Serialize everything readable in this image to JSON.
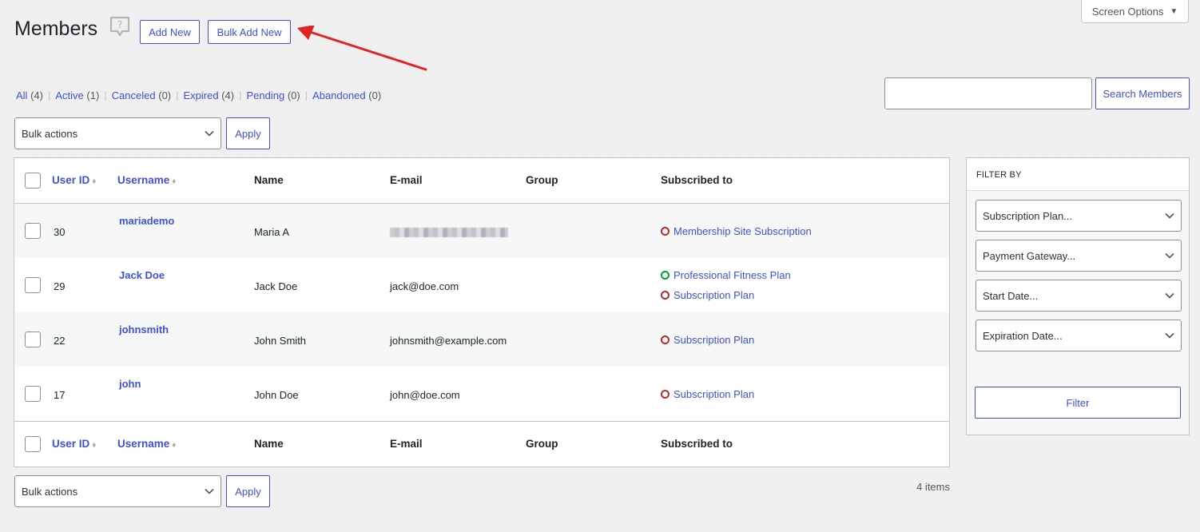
{
  "header": {
    "title": "Members",
    "add_new": "Add New",
    "bulk_add_new": "Bulk Add New",
    "screen_options": "Screen Options",
    "annotation_color": "#e02424"
  },
  "views": [
    {
      "label": "All",
      "count": "(4)",
      "current": true
    },
    {
      "label": "Active",
      "count": "(1)"
    },
    {
      "label": "Canceled",
      "count": "(0)"
    },
    {
      "label": "Expired",
      "count": "(4)"
    },
    {
      "label": "Pending",
      "count": "(0)"
    },
    {
      "label": "Abandoned",
      "count": "(0)"
    }
  ],
  "search": {
    "value": "",
    "button": "Search Members"
  },
  "bulk": {
    "selected": "Bulk actions",
    "apply": "Apply"
  },
  "table": {
    "columns": {
      "user_id": "User ID",
      "username": "Username",
      "name": "Name",
      "email": "E-mail",
      "group": "Group",
      "subscribed": "Subscribed to"
    },
    "rows": [
      {
        "id": "30",
        "username": "mariademo",
        "name": "Maria A",
        "email": "",
        "email_redacted": true,
        "group": "",
        "subs": [
          {
            "plan": "Membership Site Subscription",
            "status": "expired"
          }
        ]
      },
      {
        "id": "29",
        "username": "Jack Doe",
        "name": "Jack Doe",
        "email": "jack@doe.com",
        "group": "",
        "subs": [
          {
            "plan": "Professional Fitness Plan",
            "status": "active"
          },
          {
            "plan": "Subscription Plan",
            "status": "expired"
          }
        ]
      },
      {
        "id": "22",
        "username": "johnsmith",
        "name": "John Smith",
        "email": "johnsmith@example.com",
        "group": "",
        "subs": [
          {
            "plan": "Subscription Plan",
            "status": "expired"
          }
        ]
      },
      {
        "id": "17",
        "username": "john",
        "name": "John Doe",
        "email": "john@doe.com",
        "group": "",
        "subs": [
          {
            "plan": "Subscription Plan",
            "status": "expired"
          }
        ]
      }
    ]
  },
  "status_colors": {
    "active": "#00a32a",
    "expired": "#b32d2e"
  },
  "items_count": "4 items",
  "filter": {
    "title": "FILTER BY",
    "selects": [
      "Subscription Plan...",
      "Payment Gateway...",
      "Start Date...",
      "Expiration Date..."
    ],
    "button": "Filter"
  }
}
